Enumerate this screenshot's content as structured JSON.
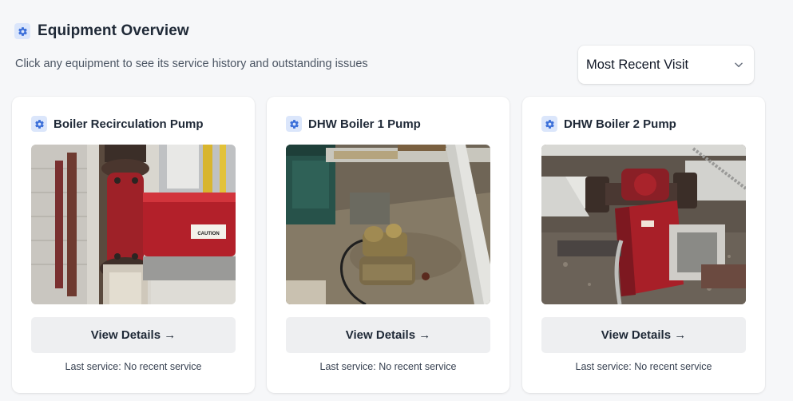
{
  "header": {
    "title": "Equipment Overview",
    "subtitle": "Click any equipment to see its service history and outstanding issues",
    "icon": "gear-icon"
  },
  "sort": {
    "selected": "Most Recent Visit"
  },
  "equipment": [
    {
      "name": "Boiler Recirculation Pump",
      "button_label": "View Details →",
      "last_service_label": "Last service:",
      "last_service_value": "No recent service",
      "photo_sign": "CAUTION"
    },
    {
      "name": "DHW Boiler 1 Pump",
      "button_label": "View Details →",
      "last_service_label": "Last service:",
      "last_service_value": "No recent service"
    },
    {
      "name": "DHW Boiler 2 Pump",
      "button_label": "View Details →",
      "last_service_label": "Last service:",
      "last_service_value": "No recent service"
    }
  ],
  "colors": {
    "accent_badge": "#dbe6fb",
    "accent_icon": "#3b6fd9",
    "pump_red": "#b3202a"
  }
}
